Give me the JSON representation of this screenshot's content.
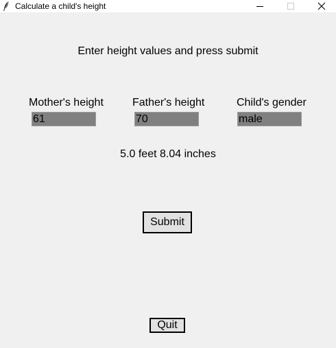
{
  "window": {
    "title": "Calculate a child's height",
    "icon": "feather-icon"
  },
  "instruction": "Enter height values and press submit",
  "fields": {
    "mother": {
      "label": "Mother's height",
      "value": "61"
    },
    "father": {
      "label": "Father's height",
      "value": "70"
    },
    "gender": {
      "label": "Child's gender",
      "value": "male"
    }
  },
  "result": "5.0 feet 8.04 inches",
  "buttons": {
    "submit": "Submit",
    "quit": "Quit"
  },
  "colors": {
    "background": "#f0f0f0",
    "entry_bg": "#808080",
    "button_bg": "#e1e1e1"
  }
}
